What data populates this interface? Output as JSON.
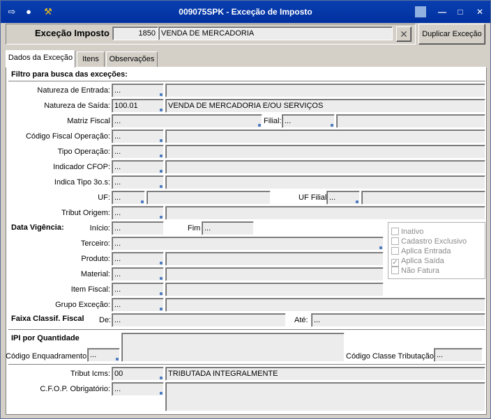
{
  "window": {
    "title": "009075SPK - Exceção de Imposto"
  },
  "header": {
    "label": "Exceção Imposto",
    "code": "1850",
    "description": "VENDA DE MERCADORIA",
    "duplicate_button": "Duplicar Exceção"
  },
  "tabs": [
    "Dados da Exceção",
    "Itens",
    "Observações"
  ],
  "filter_title": "Filtro para busca das exceções:",
  "fields": {
    "natureza_entrada": {
      "label": "Natureza de Entrada:",
      "code": "...",
      "desc": ""
    },
    "natureza_saida": {
      "label": "Natureza de Saída:",
      "code": "100.01",
      "desc": "VENDA DE MERCADORIA E/OU SERVIÇOS"
    },
    "matriz_fiscal": {
      "label": "Matriz Fiscal",
      "code": "...",
      "desc": ""
    },
    "filial": {
      "label": "Filial:",
      "code": "...",
      "desc": ""
    },
    "codigo_fiscal": {
      "label": "Código Fiscal Operação:",
      "code": "...",
      "desc": ""
    },
    "tipo_operacao": {
      "label": "Tipo Operação:",
      "code": "...",
      "desc": ""
    },
    "indicador_cfop": {
      "label": "Indicador CFOP:",
      "code": "...",
      "desc": ""
    },
    "indica_tipo": {
      "label": "Indica Tipo 3o.s:",
      "code": "...",
      "desc": ""
    },
    "uf": {
      "label": "UF:",
      "code": "...",
      "desc": ""
    },
    "uf_filial": {
      "label": "UF Filial",
      "code": "...",
      "desc": ""
    },
    "tribut_origem": {
      "label": "Tribut Origem:",
      "code": "...",
      "desc": ""
    },
    "data_vigencia": {
      "label": "Data Vigência:",
      "inicio_label": "Início:",
      "inicio": "...",
      "fim_label": "Fim",
      "fim": "..."
    },
    "terceiro": {
      "label": "Terceiro:",
      "code": "..."
    },
    "produto": {
      "label": "Produto:",
      "code": "...",
      "desc": ""
    },
    "material": {
      "label": "Material:",
      "code": "...",
      "desc": ""
    },
    "item_fiscal": {
      "label": "Item Fiscal:",
      "code": "...",
      "desc": ""
    },
    "grupo_excecao": {
      "label": "Grupo Exceção:",
      "code": "...",
      "desc": ""
    },
    "faixa": {
      "label": "Faixa Classif. Fiscal",
      "de_label": "De:",
      "de": "...",
      "ate_label": "Até:",
      "ate": "..."
    },
    "ipi_title": "IPI por Quantidade",
    "codigo_enquadramento": {
      "label": "Código Enquadramento",
      "code": "..."
    },
    "codigo_classe": {
      "label": "Código Classe Tributação",
      "code": "..."
    },
    "tribut_icms": {
      "label": "Tribut Icms:",
      "code": "00",
      "desc": "TRIBUTADA INTEGRALMENTE"
    },
    "cfop_obrigatorio": {
      "label": "C.F.O.P. Obrigatório:",
      "code": "..."
    }
  },
  "checkboxes": [
    {
      "label": "Inativo",
      "checked": false
    },
    {
      "label": "Cadastro Exclusivo",
      "checked": false
    },
    {
      "label": "Aplica Entrada",
      "checked": false
    },
    {
      "label": "Aplica Saída",
      "checked": true
    },
    {
      "label": "Não Fatura",
      "checked": false
    }
  ]
}
